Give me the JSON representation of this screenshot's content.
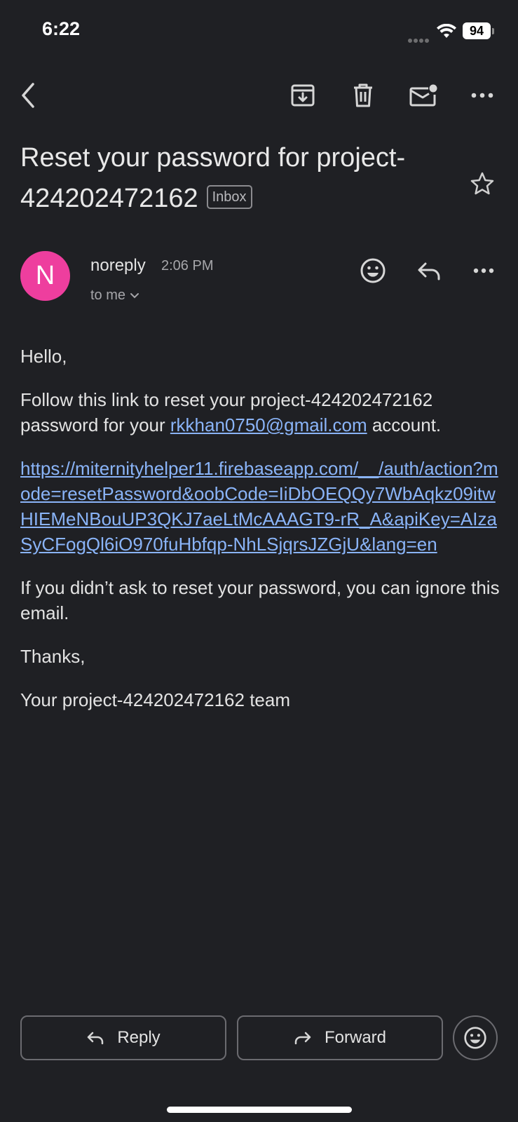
{
  "status_bar": {
    "time": "6:22",
    "battery": "94"
  },
  "email": {
    "subject": "Reset your password for project-424202472162",
    "label": "Inbox",
    "sender_initial": "N",
    "sender": "noreply",
    "time": "2:06 PM",
    "recipient": "to me",
    "greeting": "Hello,",
    "para1_prefix": "Follow this link to reset your project-424202472162 password for your ",
    "para1_email": "rkkhan0750@gmail.com",
    "para1_suffix": " account.",
    "reset_link": "https://miternityhelper11.firebaseapp.com/__/auth/action?mode=resetPassword&oobCode=IiDbOEQQy7WbAqkz09itwHIEMeNBouUP3QKJ7aeLtMcAAAGT9-rR_A&apiKey=AIzaSyCFogQl6iO970fuHbfqp-NhLSjqrsJZGjU&lang=en",
    "para2": "If you didn’t ask to reset your password, you can ignore this email.",
    "thanks": "Thanks,",
    "signature": "Your project-424202472162 team"
  },
  "actions": {
    "reply": "Reply",
    "forward": "Forward"
  },
  "colors": {
    "background": "#1f2024",
    "avatar": "#ee3e9e",
    "link": "#8ab4f8"
  }
}
